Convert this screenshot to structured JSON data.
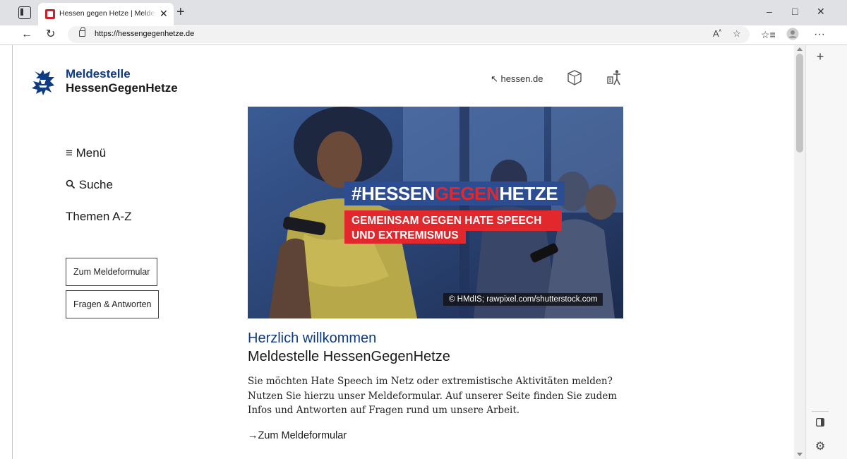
{
  "browser": {
    "tab_title": "Hessen gegen Hetze | Meldestelle",
    "tab_close": "✕",
    "new_tab": "+",
    "url": "https://hessengegenhetze.de",
    "window_controls": {
      "minimize": "–",
      "maximize": "□",
      "close": "✕"
    }
  },
  "site": {
    "logo": {
      "line1": "Meldestelle",
      "line2": "HessenGegenHetze"
    },
    "header_link": "↖ hessen.de",
    "nav": {
      "menu": "≡ Menü",
      "search": "Suche",
      "themen": "Themen A-Z"
    },
    "buttons": {
      "meldeformular": "Zum Meldeformular",
      "faq": "Fragen & Antworten"
    },
    "hero": {
      "hashtag_part1": "#HESSEN",
      "hashtag_part2": "GEGEN",
      "hashtag_part3": "HETZE",
      "claim_line1": "GEMEINSAM GEGEN HATE SPEECH",
      "claim_line2": "UND EXTREMISMUS",
      "credit": "© HMdIS; rawpixel.com/shutterstock.com"
    },
    "welcome": {
      "title": "Herzlich willkommen",
      "subtitle": "Meldestelle HessenGegenHetze",
      "body": "Sie möchten Hate Speech im Netz oder extremistische Aktivitäten melden? Nutzen Sie hierzu unser Meldeformular. Auf unserer Seite finden Sie zudem Infos und Antworten auf Fragen rund um unsere Arbeit.",
      "link": "→Zum Meldeformular"
    }
  },
  "colors": {
    "brand_blue": "#0f3b82",
    "hashtag_blue": "#2d4d92",
    "accent_red": "#e2282d"
  }
}
